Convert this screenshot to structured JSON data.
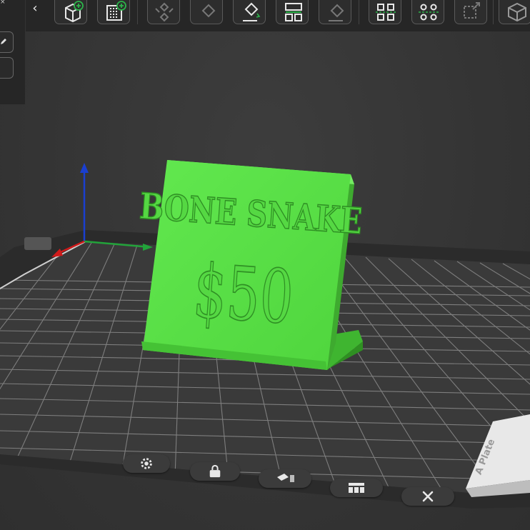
{
  "toolbar": {
    "collapse_glyph": "‹",
    "tools": [
      {
        "name": "add-object-icon"
      },
      {
        "name": "add-plate-icon"
      },
      {
        "name": "auto-orient-icon"
      },
      {
        "name": "arrange-icon"
      },
      {
        "name": "lay-on-face-icon"
      },
      {
        "name": "split-icon"
      },
      {
        "name": "cut-icon"
      },
      {
        "name": "variable-layer-icon"
      },
      {
        "name": "support-paint-icon"
      },
      {
        "name": "scale-icon"
      },
      {
        "name": "assembly-icon"
      }
    ]
  },
  "model": {
    "line1": "BONE SNAKE",
    "line2": "$50",
    "color": "#5be04a"
  },
  "plate": {
    "label": "A Plate"
  },
  "bottom_bar": {
    "buttons": [
      "settings-icon",
      "lock-icon",
      "auto-orient-icon",
      "arrange-icon",
      "close-icon"
    ]
  },
  "colors": {
    "background": "#363636",
    "toolbar": "#262626",
    "grid": "#7a7a7a",
    "axis_x": "#d01a1a",
    "axis_y": "#22a33a",
    "axis_z": "#1a3fd0"
  }
}
